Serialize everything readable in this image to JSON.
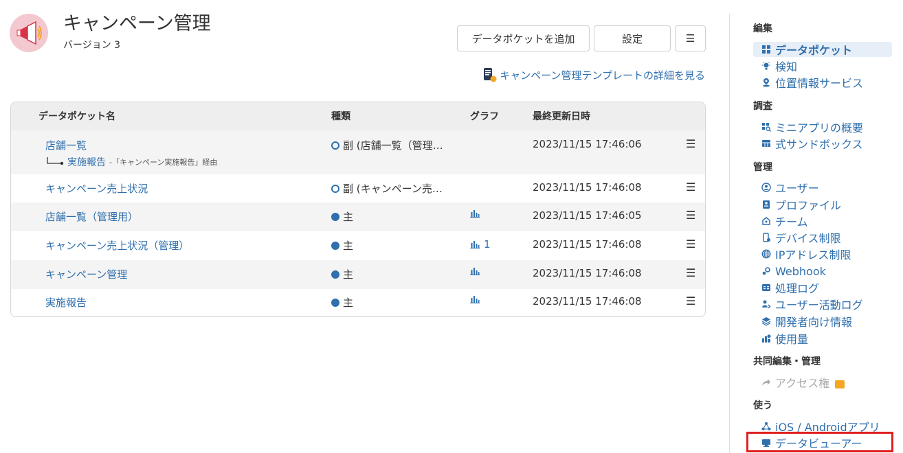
{
  "header": {
    "title": "キャンペーン管理",
    "version": "バージョン 3",
    "buttons": {
      "add": "データポケットを追加",
      "settings": "設定",
      "menu": "☰"
    },
    "template_link": "キャンペーン管理テンプレートの詳細を見る"
  },
  "table": {
    "columns": {
      "name": "データポケット名",
      "type": "種類",
      "graph": "グラフ",
      "updated": "最終更新日時"
    },
    "rows": [
      {
        "name": "店舗一覧",
        "type": "副 (店舗一覧（管理…",
        "type_kind": "sub",
        "graph": "",
        "updated": "2023/11/15 17:46:06",
        "via_link": "実施報告",
        "via_note": "-「キャンペーン実施報告」経由"
      },
      {
        "name": "キャンペーン売上状況",
        "type": "副 (キャンペーン売…",
        "type_kind": "sub",
        "graph": "",
        "updated": "2023/11/15 17:46:08"
      },
      {
        "name": "店舗一覧（管理用）",
        "type": "主",
        "type_kind": "main",
        "graph": "",
        "updated": "2023/11/15 17:46:05"
      },
      {
        "name": "キャンペーン売上状況（管理）",
        "type": "主",
        "type_kind": "main",
        "graph": "1",
        "updated": "2023/11/15 17:46:08"
      },
      {
        "name": "キャンペーン管理",
        "type": "主",
        "type_kind": "main",
        "graph": "",
        "updated": "2023/11/15 17:46:08"
      },
      {
        "name": "実施報告",
        "type": "主",
        "type_kind": "main",
        "graph": "",
        "updated": "2023/11/15 17:46:08"
      }
    ],
    "row_menu": "☰"
  },
  "sidebar": {
    "sections": {
      "edit": "編集",
      "survey": "調査",
      "manage": "管理",
      "collab": "共同編集・管理",
      "use": "使う"
    },
    "items": {
      "datapocket": "データポケット",
      "detect": "検知",
      "location": "位置情報サービス",
      "miniapp": "ミニアプリの概要",
      "sandbox": "式サンドボックス",
      "users": "ユーザー",
      "profile": "プロファイル",
      "team": "チーム",
      "device": "デバイス制限",
      "ip": "IPアドレス制限",
      "webhook": "Webhook",
      "processlog": "処理ログ",
      "activitylog": "ユーザー活動ログ",
      "developer": "開発者向け情報",
      "usage": "使用量",
      "access": "アクセス権",
      "mobileapp": "iOS / Androidアプリ",
      "dataviewer": "データビューアー"
    }
  },
  "colors": {
    "link": "#2f6fad",
    "highlight": "#e02020",
    "crown": "#f5a623"
  }
}
